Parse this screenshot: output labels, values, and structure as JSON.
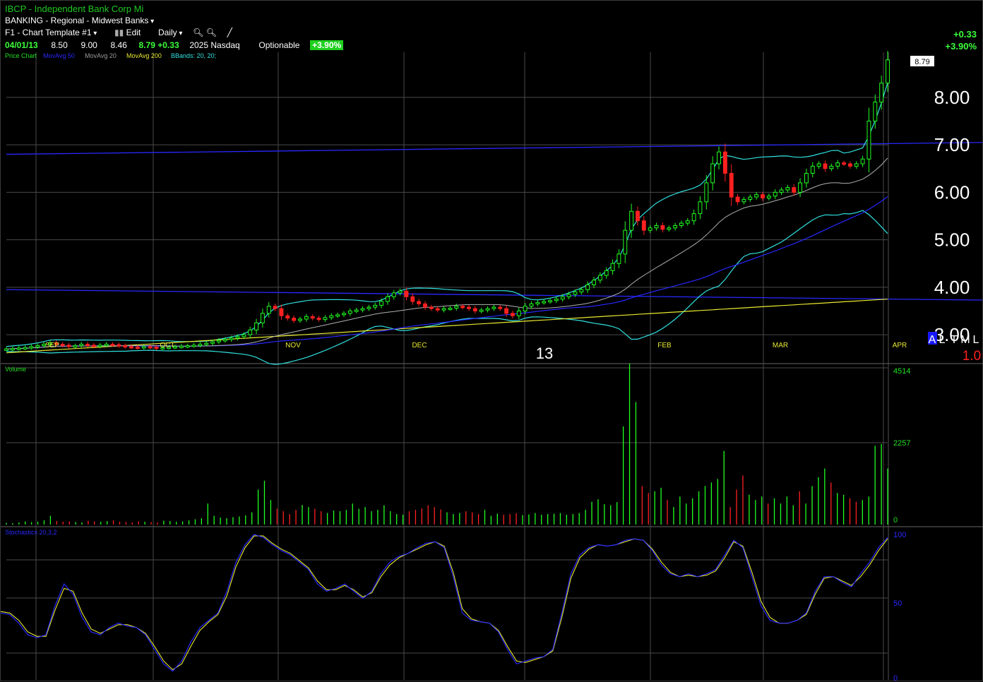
{
  "header": {
    "title": "IBCP - Independent Bank Corp Mi",
    "sector": "BANKING - Regional - Midwest Banks",
    "template": "F1 - Chart Template #1",
    "edit_label": "Edit",
    "period": "Daily",
    "date": "04/01/13",
    "open": "8.50",
    "high": "9.00",
    "low": "8.46",
    "close": "8.79",
    "change": "+0.33",
    "volume": "2025",
    "exchange": "Nasdaq",
    "optionable": "Optionable",
    "pct_change": "+3.90%",
    "right_change": "+0.33",
    "right_pct": "+3.90%"
  },
  "price_panel": {
    "legend": [
      "Price Chart",
      "MovAvg 50",
      "MovAvg 20",
      "MovAvg 200",
      "BBands: 20, 20;"
    ],
    "last_price_tag": "8.79",
    "month_labels": [
      "SEP",
      "OCT",
      "NOV",
      "DEC",
      "FEB",
      "MAR",
      "APR"
    ],
    "year_label": "13",
    "altml": [
      "A",
      "L",
      "T",
      "M",
      "L"
    ],
    "scale_factor": "1.0"
  },
  "volume_panel": {
    "label": "Volume",
    "scale": [
      "4514",
      "2257",
      "0"
    ]
  },
  "stoch_panel": {
    "label": "Stochastics 20,3,2",
    "scale": [
      "100",
      "50",
      "0"
    ]
  },
  "colors": {
    "up": "#20ff20",
    "down": "#ff2020",
    "ma50": "#2828ff",
    "ma20": "#b0b0b0",
    "ma200": "#e8e830",
    "bbands": "#30e0e0",
    "grid": "#4a4a4a"
  },
  "chart_data": {
    "type": "candlestick",
    "symbol": "IBCP",
    "y_ticks": [
      3.0,
      4.0,
      5.0,
      6.0,
      7.0,
      8.0
    ],
    "ylim": [
      2.6,
      8.95
    ],
    "trendlines": [
      {
        "from": 6.8,
        "to": 7.05
      },
      {
        "from": 3.95,
        "to": 3.73
      }
    ],
    "prices": [
      2.7,
      2.71,
      2.72,
      2.73,
      2.75,
      2.77,
      2.8,
      2.83,
      2.8,
      2.78,
      2.76,
      2.77,
      2.8,
      2.78,
      2.76,
      2.78,
      2.8,
      2.79,
      2.77,
      2.75,
      2.74,
      2.73,
      2.75,
      2.74,
      2.72,
      2.73,
      2.74,
      2.75,
      2.76,
      2.77,
      2.78,
      2.8,
      2.82,
      2.85,
      2.88,
      2.9,
      2.93,
      2.96,
      3.0,
      3.1,
      3.25,
      3.45,
      3.6,
      3.55,
      3.4,
      3.35,
      3.3,
      3.33,
      3.38,
      3.35,
      3.32,
      3.36,
      3.4,
      3.42,
      3.45,
      3.5,
      3.52,
      3.55,
      3.58,
      3.62,
      3.7,
      3.8,
      3.88,
      3.92,
      3.8,
      3.7,
      3.65,
      3.58,
      3.55,
      3.52,
      3.55,
      3.56,
      3.6,
      3.58,
      3.55,
      3.5,
      3.52,
      3.55,
      3.58,
      3.55,
      3.45,
      3.4,
      3.5,
      3.6,
      3.65,
      3.68,
      3.7,
      3.72,
      3.75,
      3.8,
      3.85,
      3.9,
      3.95,
      4.05,
      4.15,
      4.25,
      4.35,
      4.5,
      4.7,
      5.2,
      5.6,
      5.4,
      5.2,
      5.25,
      5.3,
      5.22,
      5.25,
      5.3,
      5.35,
      5.4,
      5.55,
      5.8,
      6.2,
      6.6,
      6.85,
      6.4,
      5.9,
      5.8,
      5.85,
      5.9,
      5.95,
      5.88,
      5.92,
      6.0,
      6.05,
      6.1,
      6.0,
      6.2,
      6.4,
      6.55,
      6.6,
      6.5,
      6.55,
      6.62,
      6.6,
      6.55,
      6.6,
      6.7,
      7.5,
      7.9,
      8.3,
      8.79
    ],
    "volume": [
      50,
      40,
      60,
      90,
      70,
      80,
      120,
      250,
      100,
      80,
      90,
      70,
      60,
      110,
      90,
      80,
      100,
      120,
      80,
      70,
      60,
      90,
      80,
      70,
      60,
      110,
      100,
      80,
      90,
      120,
      150,
      180,
      600,
      250,
      200,
      180,
      210,
      230,
      260,
      350,
      1000,
      1250,
      700,
      450,
      380,
      300,
      420,
      560,
      500,
      450,
      380,
      330,
      400,
      380,
      420,
      600,
      450,
      500,
      380,
      420,
      550,
      380,
      300,
      280,
      380,
      420,
      460,
      550,
      500,
      430,
      350,
      300,
      330,
      380,
      350,
      300,
      420,
      250,
      310,
      280,
      300,
      320,
      270,
      290,
      330,
      280,
      300,
      310,
      330,
      280,
      300,
      330,
      420,
      650,
      720,
      580,
      550,
      640,
      2800,
      4600,
      3500,
      1100,
      900,
      950,
      1050,
      700,
      500,
      800,
      600,
      750,
      950,
      1100,
      1200,
      1300,
      2100,
      500,
      1000,
      1400,
      850,
      700,
      800,
      600,
      750,
      600,
      800,
      550,
      950,
      600,
      1100,
      1350,
      1600,
      1200,
      900,
      850,
      750,
      650,
      700,
      800,
      2250,
      2300,
      1600
    ],
    "stochastic": [
      45,
      44,
      38,
      30,
      28,
      30,
      50,
      65,
      58,
      42,
      32,
      30,
      35,
      38,
      36,
      35,
      30,
      20,
      10,
      5,
      12,
      25,
      35,
      40,
      45,
      60,
      80,
      92,
      99,
      97,
      92,
      88,
      85,
      80,
      75,
      65,
      60,
      62,
      65,
      60,
      55,
      60,
      72,
      80,
      84,
      86,
      90,
      93,
      94,
      90,
      70,
      45,
      40,
      39,
      38,
      32,
      20,
      10,
      12,
      14,
      15,
      20,
      45,
      72,
      85,
      90,
      92,
      91,
      92,
      95,
      96,
      95,
      88,
      78,
      72,
      70,
      72,
      70,
      72,
      75,
      85,
      95,
      90,
      70,
      50,
      40,
      38,
      38,
      40,
      45,
      60,
      70,
      70,
      66,
      63,
      72,
      80,
      90,
      97
    ],
    "stochastic_signal": [
      46,
      45,
      40,
      32,
      29,
      29,
      47,
      62,
      60,
      45,
      34,
      31,
      34,
      37,
      37,
      35,
      31,
      22,
      12,
      6,
      10,
      22,
      33,
      39,
      44,
      57,
      77,
      90,
      98,
      98,
      93,
      89,
      86,
      81,
      76,
      67,
      61,
      61,
      64,
      61,
      56,
      59,
      70,
      78,
      83,
      86,
      89,
      92,
      94,
      91,
      73,
      48,
      41,
      39,
      38,
      33,
      22,
      12,
      11,
      13,
      15,
      19,
      42,
      69,
      83,
      89,
      92,
      91,
      92,
      94,
      96,
      95,
      89,
      80,
      73,
      70,
      71,
      70,
      71,
      74,
      83,
      94,
      91,
      73,
      53,
      42,
      38,
      38,
      40,
      44,
      58,
      69,
      70,
      67,
      64,
      70,
      78,
      88,
      96
    ]
  }
}
